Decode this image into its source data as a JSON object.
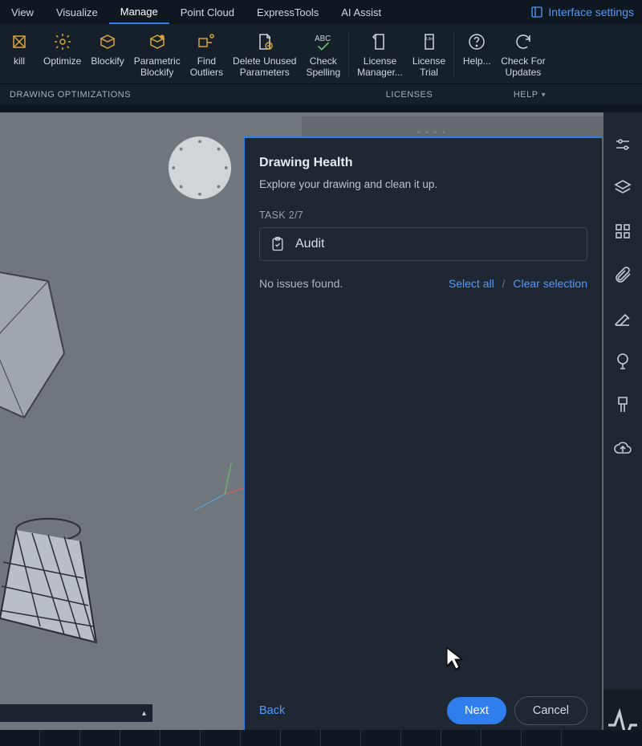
{
  "menu": {
    "tabs": [
      "View",
      "Visualize",
      "Manage",
      "Point Cloud",
      "ExpressTools",
      "AI Assist"
    ],
    "active": "Manage",
    "interface_settings": "Interface settings"
  },
  "ribbon": {
    "buttons": {
      "kill": "kill",
      "optimize": "Optimize",
      "blockify": "Blockify",
      "parametric_blockify": "Parametric\nBlockify",
      "find_outliers": "Find\nOutliers",
      "delete_unused": "Delete Unused\nParameters",
      "check_spelling": "Check\nSpelling",
      "license_manager": "License\nManager...",
      "license_trial": "License\nTrial",
      "help": "Help...",
      "check_updates": "Check For\nUpdates"
    },
    "groups": {
      "drawing_opt": "DRAWING OPTIMIZATIONS",
      "licenses": "LICENSES",
      "help": "HELP"
    }
  },
  "panel": {
    "title": "Drawing Health",
    "subtitle": "Explore your drawing and clean it up.",
    "task_label": "TASK 2/7",
    "task_name": "Audit",
    "no_issues": "No issues found.",
    "select_all": "Select all",
    "clear_selection": "Clear selection",
    "back": "Back",
    "next": "Next",
    "cancel": "Cancel"
  }
}
